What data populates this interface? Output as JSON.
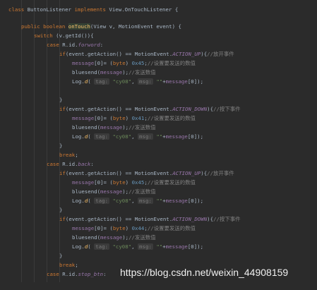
{
  "code": {
    "l01": {
      "kw": "class",
      "name": "ButtonListener",
      "kw2": "implements",
      "iface": "View.OnTouchListener {"
    },
    "l03": {
      "kw": "public boolean",
      "method": "onTouch",
      "rest": "(View v, MotionEvent event) {"
    },
    "l04": {
      "kw": "switch",
      "rest": "(v.getId()){"
    },
    "case_kw": "case",
    "break_kw": "break",
    "if_kw": "if",
    "byte_kw": "byte",
    "rid": "R.id.",
    "id_forword": "forword",
    "id_back": "back",
    "id_stop": "stop_btn",
    "if_pre": "(event.getAction() == MotionEvent.",
    "if_post": "){",
    "action_up": "ACTION_UP",
    "action_down": "ACTION_DOWN",
    "cmt_up": "//放开事件",
    "cmt_down": "//按下事件",
    "message": "message",
    "msg_idx": "[0]= (",
    "byte_close": ") ",
    "hex_45": "0x45",
    "hex_41": "0x41",
    "hex_44": "0x44",
    "semi": ";",
    "cmt_set": "//设置要发送的数值",
    "bluesend": "bluesend(",
    "bluesend_close": ");",
    "cmt_send": "//发送数值",
    "logd_pre": "Log.",
    "logd_fn": "d",
    "paren": "(",
    "tag_hint": "tag:",
    "tag_val": "\"cy08\"",
    "comma": ", ",
    "msg_hint": "msg:",
    "msg_str": "\"\"",
    "plus": "+",
    "msg_tail": "[0]);",
    "close_brace": "}"
  },
  "watermark": "https://blog.csdn.net/weixin_44908159"
}
